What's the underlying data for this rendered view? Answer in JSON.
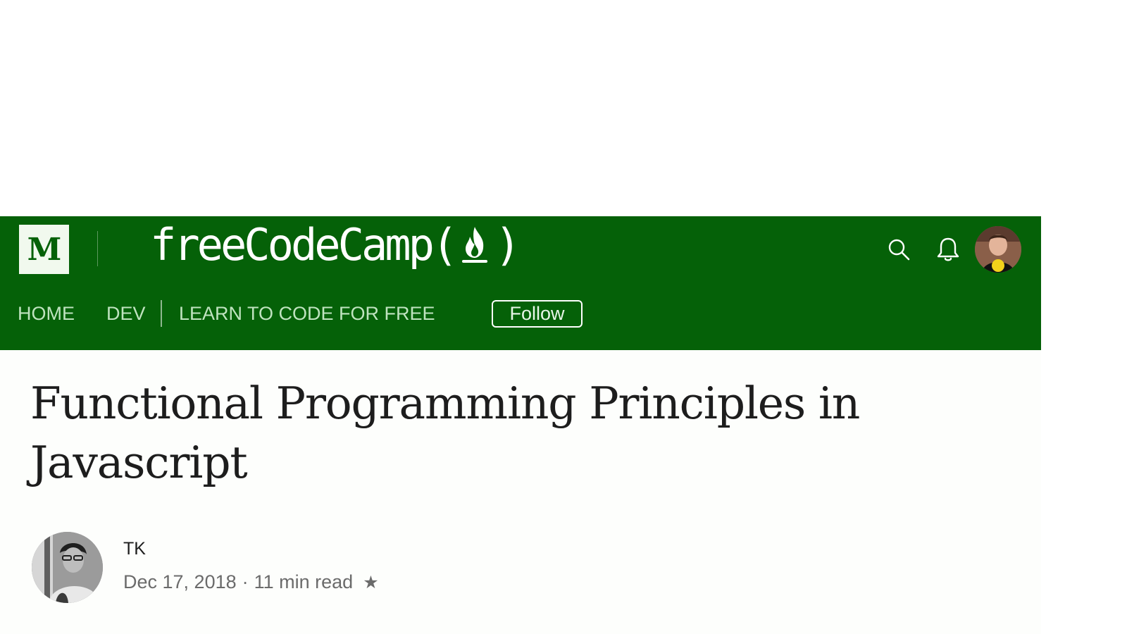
{
  "header": {
    "medium_logo": "M",
    "brand": {
      "name": "freeCodeCamp",
      "open_paren": "(",
      "close_paren": ")"
    },
    "icons": {
      "search": "search-icon",
      "notifications": "bell-icon",
      "avatar": "user-avatar"
    },
    "colors": {
      "header_bg": "#056108",
      "nav_text": "#bfe3bf",
      "logo_bg": "#f1f9ee"
    }
  },
  "nav": {
    "items": [
      {
        "label": "HOME"
      },
      {
        "label": "DEV"
      },
      {
        "label": "LEARN TO CODE FOR FREE"
      }
    ],
    "follow_label": "Follow"
  },
  "article": {
    "title": "Functional Programming Principles in Javascript",
    "author": {
      "name": "TK"
    },
    "date": "Dec 17, 2018",
    "separator": "·",
    "read_time": "11 min read",
    "star": "★"
  }
}
